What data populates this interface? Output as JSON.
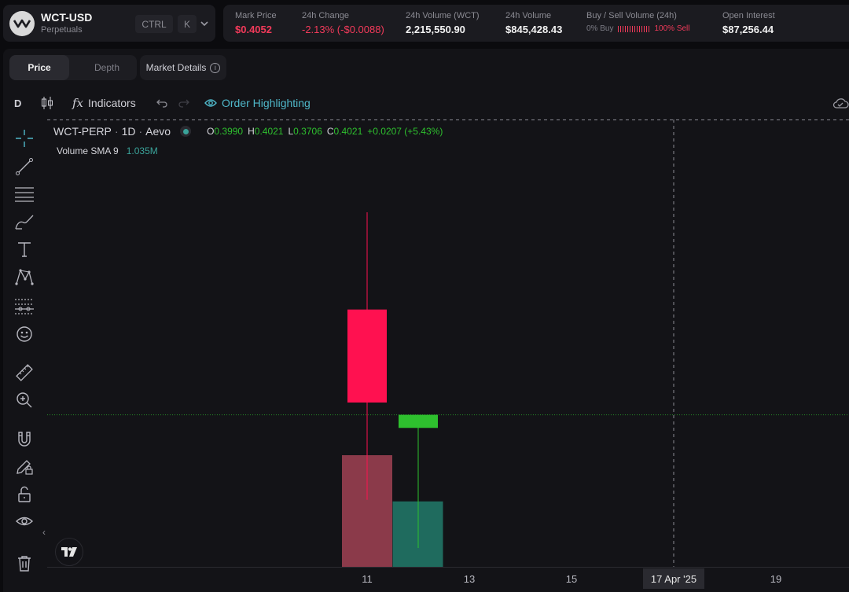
{
  "header": {
    "symbol": "WCT-USD",
    "subtitle": "Perpetuals",
    "shortcut_ctrl": "CTRL",
    "shortcut_k": "K",
    "icons": {
      "logo": "wct-logo-icon",
      "dropdown": "chevron-down-icon"
    }
  },
  "stats": {
    "mark_price": {
      "label": "Mark Price",
      "value": "$0.4052"
    },
    "change_24h": {
      "label": "24h Change",
      "value": "-2.13% (-$0.0088)"
    },
    "volume_wct": {
      "label": "24h Volume (WCT)",
      "value": "2,215,550.90"
    },
    "volume_usd": {
      "label": "24h Volume",
      "value": "$845,428.43"
    },
    "buy_sell": {
      "label": "Buy / Sell Volume (24h)",
      "buy": "0% Buy",
      "sell": "100% Sell",
      "buy_fraction": 0.0
    },
    "open_interest": {
      "label": "Open Interest",
      "value": "$87,256.44"
    },
    "colors": {
      "negative": "#f23a5a",
      "positive": "#2ec02e"
    }
  },
  "tabs": [
    {
      "label": "Price",
      "active": true
    },
    {
      "label": "Depth",
      "active": false
    }
  ],
  "market_details": {
    "label": "Market Details"
  },
  "toolbar": {
    "interval": "D",
    "indicators": "Indicators",
    "order_highlighting": "Order Highlighting",
    "icons": [
      "candlestick-icon",
      "fx-icon",
      "undo-icon",
      "redo-icon",
      "eye-icon",
      "cloud-icon"
    ]
  },
  "left_tools": [
    "crosshair-icon",
    "trend-line-icon",
    "fib-lines-icon",
    "brush-icon",
    "text-icon",
    "pattern-icon",
    "forecast-icon",
    "emoji-icon",
    "ruler-icon",
    "zoom-in-icon",
    "magnet-icon",
    "lock-drawing-icon",
    "unlock-icon",
    "eye-icon",
    "trash-icon"
  ],
  "chart": {
    "legend": {
      "symbol": "WCT-PERP",
      "interval": "1D",
      "exchange": "Aevo",
      "sep": "·",
      "o_label": "O",
      "o_value": "0.3990",
      "h_label": "H",
      "h_value": "0.4021",
      "l_label": "L",
      "l_value": "0.3706",
      "c_label": "C",
      "c_value": "0.4021",
      "change": "+0.0207 (+5.43%)",
      "volume_label": "Volume SMA 9",
      "volume_value": "1.035M"
    },
    "crosshair_label": "17 Apr '25",
    "tradingview_icon": "tradingview-logo-icon"
  },
  "chart_data": {
    "type": "candlestick",
    "x_ticks": [
      "11",
      "13",
      "15",
      "19"
    ],
    "candles": [
      {
        "x": "11",
        "open": 0.427,
        "high": 0.45,
        "low": 0.382,
        "close": 0.405,
        "color": "#ff1150"
      },
      {
        "x": "12",
        "open": 0.399,
        "high": 0.4021,
        "low": 0.3706,
        "close": 0.4021,
        "color": "#2ec02e"
      }
    ],
    "volume": [
      {
        "x": "11",
        "value": 1.45,
        "color": "#8b3a4a"
      },
      {
        "x": "12",
        "value": 0.85,
        "color": "#1f6b5e"
      }
    ],
    "volume_unit": "M",
    "current_price_line": 0.4021
  }
}
